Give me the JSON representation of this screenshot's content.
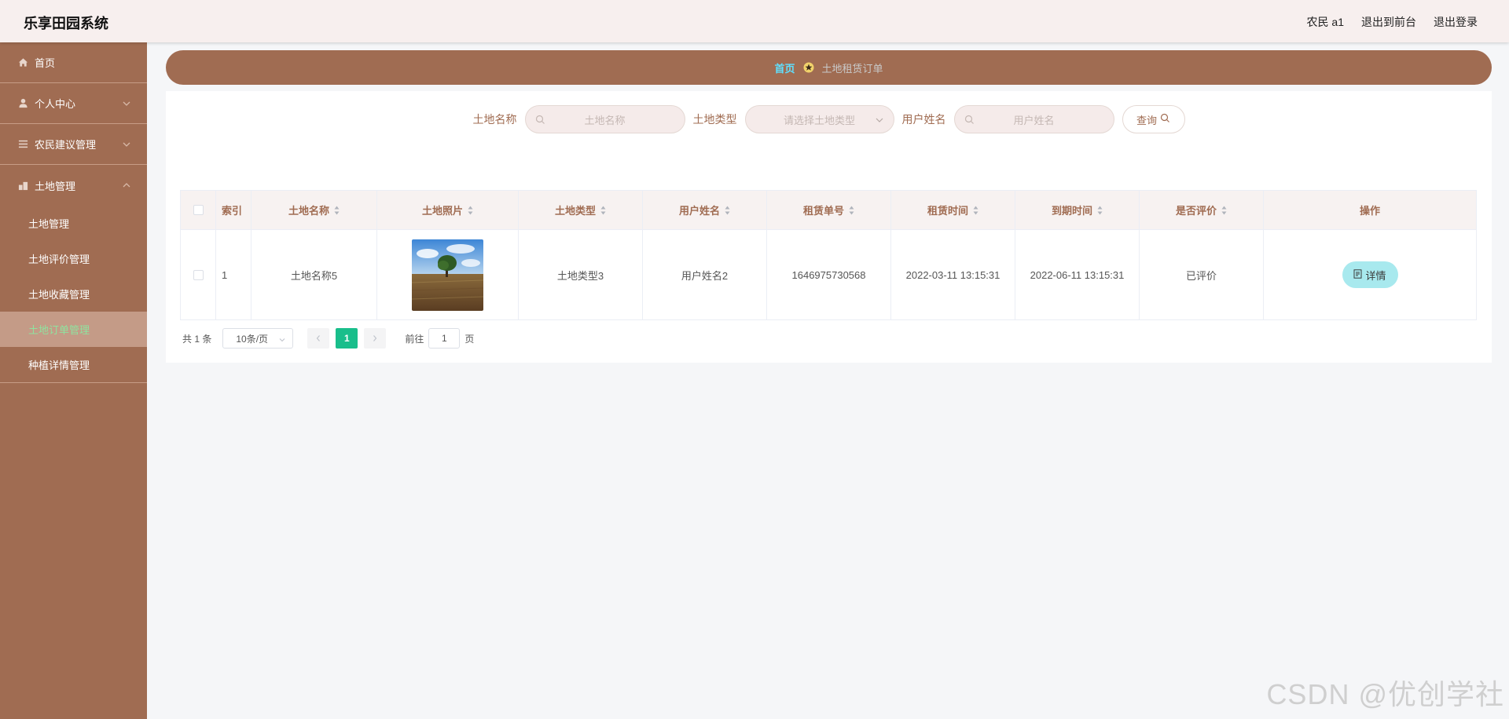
{
  "header": {
    "app_title": "乐享田园系统",
    "user_label": "农民 a1",
    "to_front": "退出到前台",
    "logout": "退出登录"
  },
  "sidebar": {
    "items": [
      {
        "label": "首页",
        "icon": "home-icon"
      },
      {
        "label": "个人中心",
        "icon": "user-icon"
      },
      {
        "label": "农民建议管理",
        "icon": "list-icon"
      },
      {
        "label": "土地管理",
        "icon": "building-icon"
      }
    ],
    "sub_items": [
      {
        "label": "土地管理"
      },
      {
        "label": "土地评价管理"
      },
      {
        "label": "土地收藏管理"
      },
      {
        "label": "土地订单管理",
        "active": true
      },
      {
        "label": "种植详情管理"
      }
    ]
  },
  "breadcrumb": {
    "home": "首页",
    "current": "土地租赁订单"
  },
  "search": {
    "land_name_label": "土地名称",
    "land_name_placeholder": "土地名称",
    "land_type_label": "土地类型",
    "land_type_placeholder": "请选择土地类型",
    "user_name_label": "用户姓名",
    "user_name_placeholder": "用户姓名",
    "query_button": "查询"
  },
  "table": {
    "headers": {
      "index": "索引",
      "land_name": "土地名称",
      "land_photo": "土地照片",
      "land_type": "土地类型",
      "user_name": "用户姓名",
      "order_no": "租赁单号",
      "rent_time": "租赁时间",
      "expire_time": "到期时间",
      "evaluated": "是否评价",
      "actions": "操作"
    },
    "rows": [
      {
        "index": "1",
        "land_name": "土地名称5",
        "land_type": "土地类型3",
        "user_name": "用户姓名2",
        "order_no": "1646975730568",
        "rent_time": "2022-03-11 13:15:31",
        "expire_time": "2022-06-11 13:15:31",
        "evaluated": "已评价",
        "detail_button": "详情"
      }
    ]
  },
  "pagination": {
    "total": "共 1 条",
    "page_size": "10条/页",
    "current_page": "1",
    "goto_label": "前往",
    "goto_value": "1",
    "page_suffix": "页"
  },
  "watermark": "CSDN @优创学社",
  "colors": {
    "sidebar_bg": "#a06c52",
    "active_text": "#8fe39f",
    "breadcrumb_home": "#5fe0ff",
    "page_active": "#19be8b",
    "detail_button": "#a8e9ee"
  }
}
